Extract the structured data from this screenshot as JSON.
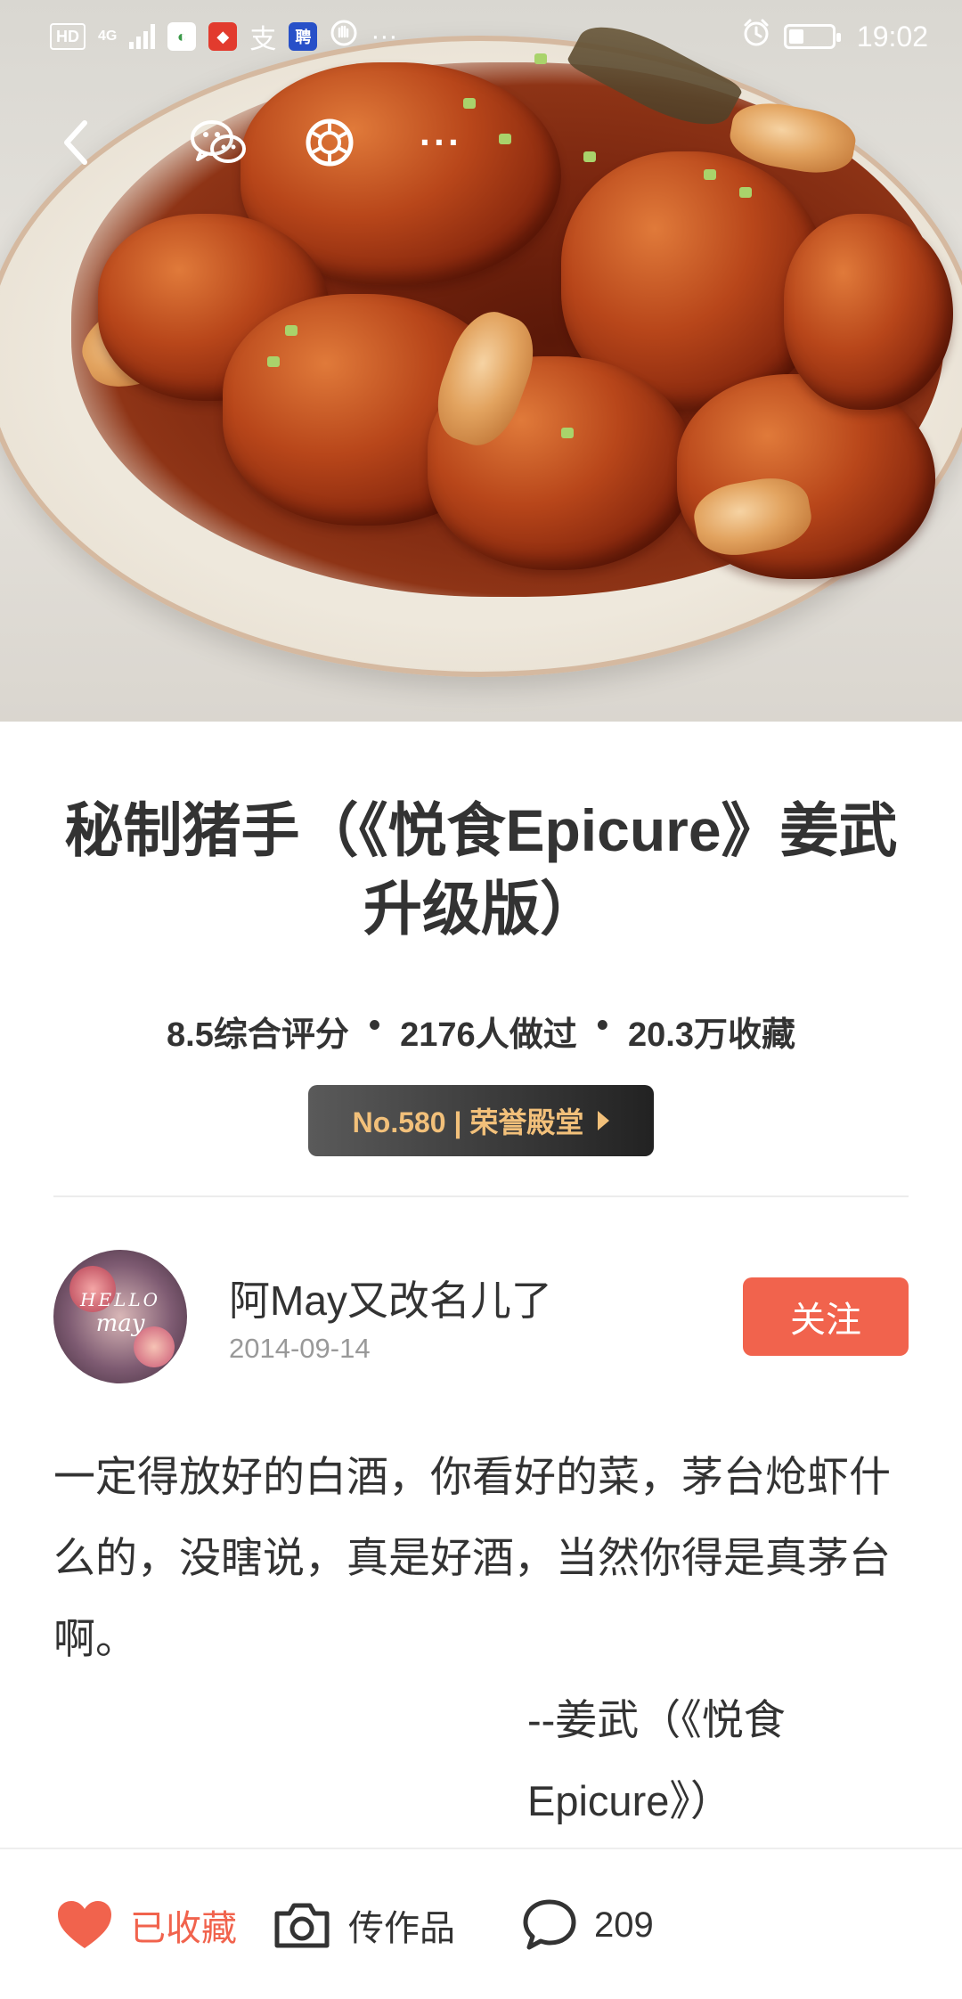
{
  "status_bar": {
    "left_icons": [
      "hd-icon",
      "signal-4g-icon",
      "app-icon-green",
      "app-icon-red",
      "app-icon-zhi",
      "app-icon-pin",
      "app-icon-hand"
    ],
    "hd_label": "HD",
    "net_label": "4G",
    "zhi_label": "支",
    "pin_label": "聘",
    "more_label": "···",
    "time": "19:02"
  },
  "nav": {
    "more_label": "···"
  },
  "recipe": {
    "title": "秘制猪手（《悦食Epicure》姜武升级版）",
    "rating": "8.5综合评分",
    "made_count": "2176人做过",
    "favorites": "20.3万收藏",
    "separator": "•",
    "badge_label": "No.580 | 荣誉殿堂"
  },
  "author": {
    "name": "阿May又改名儿了",
    "date": "2014-09-14",
    "avatar_text_1": "HELLO",
    "avatar_text_2": "may",
    "follow_label": "关注"
  },
  "description": {
    "body": "一定得放好的白酒，你看好的菜，茅台炝虾什么的，没瞎说，真是好酒，当然你得是真茅台啊。",
    "signature": "--姜武（《悦食Epicure》）"
  },
  "bottom_bar": {
    "favorite_label": "已收藏",
    "upload_label": "传作品",
    "comment_count": "209"
  },
  "colors": {
    "accent": "#f1634d",
    "badge_text": "#f2c07a",
    "badge_bg": "#333333"
  }
}
